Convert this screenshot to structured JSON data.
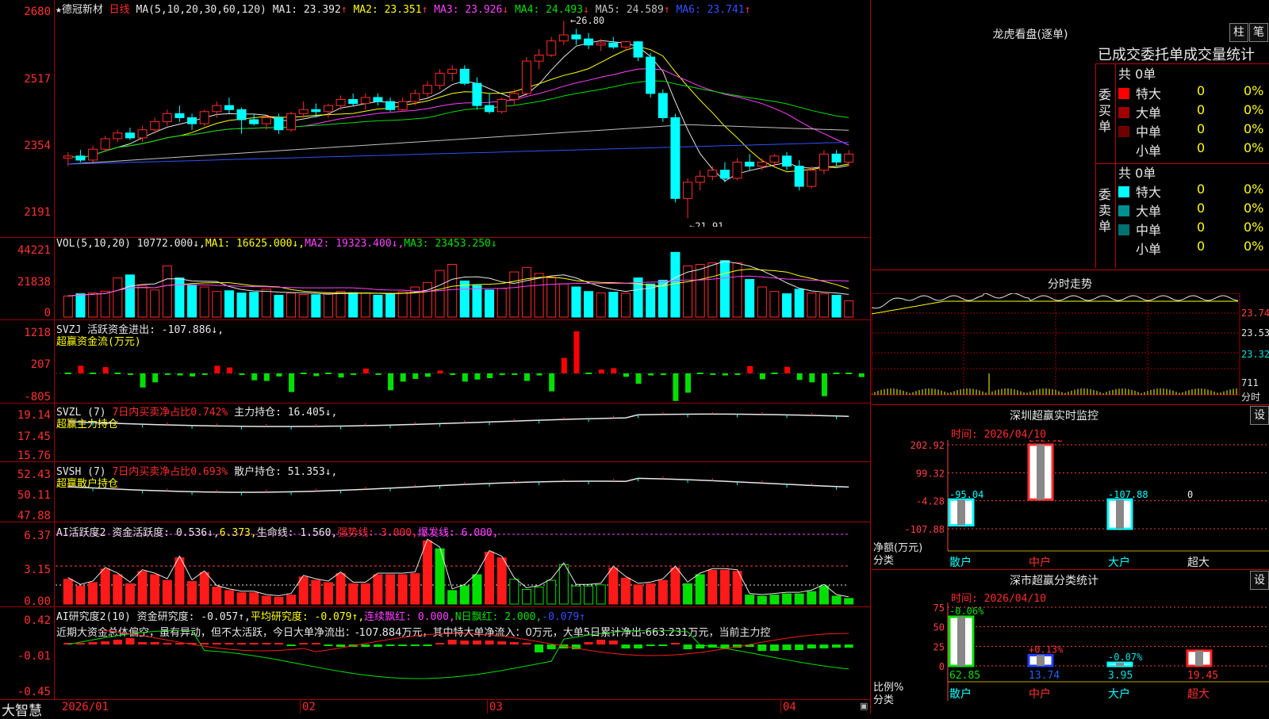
{
  "stock": {
    "title": "德冠新材",
    "period": "日线",
    "ma_label": "MA(5,10,20,30,60,120)",
    "ma": [
      {
        "label": "MA1: 23.392",
        "arrow": "↑",
        "color": "#e8e8e8"
      },
      {
        "label": "MA2: 23.351",
        "arrow": "↑",
        "color": "#ffff00"
      },
      {
        "label": "MA3: 23.926",
        "arrow": "↓",
        "color": "#ff40ff"
      },
      {
        "label": "MA4: 24.493",
        "arrow": "↓",
        "color": "#00e000"
      },
      {
        "label": "MA5: 24.589",
        "arrow": "↑",
        "color": "#c0c0c0"
      },
      {
        "label": "MA6: 23.741",
        "arrow": "↑",
        "color": "#3050ff"
      }
    ],
    "price_axis": [
      "2680",
      "2517",
      "2354",
      "2191"
    ],
    "high_marker": "26.80",
    "low_marker": "21.91"
  },
  "chart_data": [
    {
      "type": "candlestick",
      "title": "德冠新材 日线",
      "x": [
        "2026/01",
        "02",
        "03",
        "04"
      ],
      "ylim": [
        21.91,
        26.8
      ],
      "ohlc": [
        [
          23.4,
          23.55,
          23.2,
          23.45
        ],
        [
          23.45,
          23.6,
          23.3,
          23.35
        ],
        [
          23.35,
          23.7,
          23.3,
          23.62
        ],
        [
          23.62,
          23.95,
          23.55,
          23.88
        ],
        [
          23.88,
          24.1,
          23.8,
          24.02
        ],
        [
          24.02,
          24.15,
          23.85,
          23.9
        ],
        [
          23.9,
          24.2,
          23.8,
          24.1
        ],
        [
          24.1,
          24.4,
          24.0,
          24.3
        ],
        [
          24.3,
          24.6,
          24.2,
          24.5
        ],
        [
          24.5,
          24.7,
          24.3,
          24.4
        ],
        [
          24.4,
          24.5,
          24.1,
          24.25
        ],
        [
          24.25,
          24.6,
          24.2,
          24.55
        ],
        [
          24.55,
          24.8,
          24.4,
          24.7
        ],
        [
          24.7,
          24.9,
          24.5,
          24.6
        ],
        [
          24.6,
          24.65,
          24.0,
          24.35
        ],
        [
          24.35,
          24.5,
          24.2,
          24.25
        ],
        [
          24.25,
          24.45,
          24.1,
          24.4
        ],
        [
          24.4,
          24.5,
          24.0,
          24.1
        ],
        [
          24.1,
          24.55,
          24.05,
          24.5
        ],
        [
          24.5,
          24.8,
          24.4,
          24.6
        ],
        [
          24.6,
          24.75,
          24.4,
          24.55
        ],
        [
          24.55,
          24.75,
          24.4,
          24.7
        ],
        [
          24.7,
          24.95,
          24.6,
          24.85
        ],
        [
          24.85,
          25.0,
          24.7,
          24.75
        ],
        [
          24.75,
          25.0,
          24.6,
          24.9
        ],
        [
          24.9,
          25.0,
          24.7,
          24.8
        ],
        [
          24.8,
          24.9,
          24.55,
          24.6
        ],
        [
          24.6,
          24.9,
          24.55,
          24.8
        ],
        [
          24.8,
          25.1,
          24.7,
          25.0
        ],
        [
          25.0,
          25.3,
          24.9,
          25.2
        ],
        [
          25.2,
          25.6,
          25.1,
          25.5
        ],
        [
          25.5,
          25.7,
          25.3,
          25.6
        ],
        [
          25.6,
          25.7,
          25.2,
          25.25
        ],
        [
          25.25,
          25.4,
          24.6,
          24.7
        ],
        [
          24.7,
          25.0,
          24.5,
          24.55
        ],
        [
          24.55,
          24.9,
          24.5,
          24.85
        ],
        [
          24.85,
          25.1,
          24.7,
          25.0
        ],
        [
          25.0,
          25.9,
          24.95,
          25.8
        ],
        [
          25.8,
          26.1,
          25.6,
          25.95
        ],
        [
          25.95,
          26.4,
          25.9,
          26.3
        ],
        [
          26.3,
          26.8,
          26.2,
          26.45
        ],
        [
          26.45,
          26.6,
          26.2,
          26.35
        ],
        [
          26.35,
          26.5,
          26.1,
          26.2
        ],
        [
          26.2,
          26.35,
          26.05,
          26.25
        ],
        [
          26.25,
          26.4,
          26.1,
          26.15
        ],
        [
          26.15,
          26.3,
          26.05,
          26.28
        ],
        [
          26.28,
          26.3,
          25.8,
          25.9
        ],
        [
          25.9,
          26.0,
          24.9,
          25.0
        ],
        [
          25.0,
          25.1,
          24.3,
          24.4
        ],
        [
          24.4,
          24.5,
          22.3,
          22.4
        ],
        [
          22.4,
          22.9,
          21.91,
          22.8
        ],
        [
          22.8,
          23.1,
          22.6,
          22.95
        ],
        [
          22.95,
          23.2,
          22.85,
          23.1
        ],
        [
          23.1,
          23.3,
          22.8,
          22.9
        ],
        [
          22.9,
          23.4,
          22.85,
          23.3
        ],
        [
          23.3,
          23.5,
          23.1,
          23.2
        ],
        [
          23.2,
          23.4,
          23.1,
          23.3
        ],
        [
          23.3,
          23.5,
          23.2,
          23.45
        ],
        [
          23.45,
          23.55,
          23.1,
          23.2
        ],
        [
          23.2,
          23.35,
          22.6,
          22.7
        ],
        [
          22.7,
          23.2,
          22.65,
          23.1
        ],
        [
          23.1,
          23.6,
          23.0,
          23.5
        ],
        [
          23.5,
          23.6,
          23.2,
          23.3
        ],
        [
          23.3,
          23.6,
          23.2,
          23.5
        ]
      ]
    },
    {
      "type": "bar",
      "title": "VOL(5,10,20)",
      "ylim": [
        0,
        44221
      ],
      "values": [
        14000,
        15500,
        16000,
        17200,
        26000,
        28000,
        21000,
        18000,
        34000,
        26000,
        21000,
        20000,
        17000,
        17500,
        16000,
        16500,
        18500,
        14500,
        16000,
        15000,
        14800,
        15600,
        17000,
        16200,
        16000,
        14500,
        15200,
        16800,
        20000,
        23000,
        31000,
        35000,
        24000,
        21000,
        18000,
        19000,
        30000,
        33000,
        29000,
        26000,
        22000,
        20000,
        17000,
        16000,
        16500,
        15800,
        26000,
        22000,
        24500,
        43000,
        34000,
        35000,
        36000,
        37500,
        36000,
        25000,
        20000,
        17000,
        15500,
        18500,
        16000,
        15500,
        14500,
        10772
      ],
      "series_labels": [
        "VOL(5,10,20) 10772.000↓",
        "MA1: 16625.000↓",
        "MA2: 19323.400↓",
        "MA3: 23453.250↓"
      ]
    },
    {
      "type": "bar",
      "title": "SVZJ 活跃资金进出",
      "ylim": [
        -805,
        1218
      ],
      "values": [
        0,
        220,
        0,
        180,
        0,
        -40,
        -410,
        -260,
        -40,
        -60,
        -90,
        -40,
        220,
        170,
        -40,
        -200,
        -220,
        -90,
        -540,
        0,
        -80,
        0,
        -120,
        -40,
        140,
        -40,
        -490,
        -240,
        -160,
        -100,
        80,
        -40,
        -240,
        -180,
        -140,
        -50,
        -40,
        -220,
        -60,
        -520,
        450,
        1218,
        0,
        110,
        150,
        -100,
        -300,
        -60,
        -50,
        -800,
        -560,
        0,
        -40,
        -60,
        -40,
        210,
        -170,
        0,
        190,
        -190,
        -260,
        -660,
        0,
        0,
        -107.886
      ]
    }
  ],
  "indicators": {
    "vol": {
      "axis": [
        "44221",
        "21838",
        "0"
      ],
      "title": "VOL(5,10,20)",
      "value": "10772.000↓,",
      "ma1": "MA1: 16625.000↓,",
      "ma2": "MA2: 19323.400↓,",
      "ma3": "MA3: 23453.250↓"
    },
    "svzj": {
      "axis": [
        "1218",
        "207",
        "-805"
      ],
      "line1": "SVZJ  活跃资金进出: -107.886↓,",
      "line2": "超赢资金流(万元)"
    },
    "svzl": {
      "axis": [
        "19.14",
        "17.45",
        "15.76"
      ],
      "line1_prefix": "SVZL (7) ",
      "line1_red": "7日内买卖净占比0.742%",
      "line1_suffix": " 主力持仓: 16.405↓,",
      "line2": "超赢主力持仓"
    },
    "svsh": {
      "axis": [
        "52.43",
        "50.11",
        "47.88"
      ],
      "line1_prefix": "SVSH (7) ",
      "line1_red": "7日内买卖净占比0.693%",
      "line1_suffix": " 散户持仓: 51.353↓,",
      "line2": "超赢散户持仓"
    },
    "ai_active": {
      "axis": [
        "6.37",
        "3.15",
        "0.00"
      ],
      "label": "AI活跃度2 资金活跃度: 0.536↓,",
      "v2": "6.373,",
      "v3": "生命线: 1.560,",
      "v4": "强势线: 3.000,",
      "v5": "爆发线: 6.000,"
    },
    "ai_research": {
      "axis": [
        "0.42",
        "-0.01",
        "-0.45"
      ],
      "label": "AI研究度2(10) 资金研究度: -0.057↑,",
      "v2": "平均研究度: -0.079↑,",
      "v3": "连续飘红: 0.000,",
      "v4": "N日飘红: 2.000,",
      "v5": "-0.079↑",
      "summary": "近期大资金总体偏空，虽有异动，但不太活跃，今日大单净流出：-107.884万元，其中特大单净流入：0万元，大单5日累计净出-663.231万元，当前主力控"
    }
  },
  "x_axis": [
    "2026/01",
    "02",
    "03",
    "04"
  ],
  "brand": "大智慧",
  "right": {
    "lhb_title": "龙虎看盘(逐单)",
    "btn_bar": "柱",
    "btn_pen": "笔",
    "stat_header": "已成交委托单成交量统计",
    "buy_total": "共 0单",
    "sell_total": "共 0单",
    "buy_side": "委买单",
    "sell_side": "委卖单",
    "buy_rows": [
      {
        "name": "特大",
        "val": "0",
        "pct": "0%",
        "color": "#ff0000"
      },
      {
        "name": "大单",
        "val": "0",
        "pct": "0%",
        "color": "#a00000"
      },
      {
        "name": "中单",
        "val": "0",
        "pct": "0%",
        "color": "#700000"
      },
      {
        "name": "小单",
        "val": "0",
        "pct": "0%",
        "color": "#000000"
      }
    ],
    "sell_rows": [
      {
        "name": "特大",
        "val": "0",
        "pct": "0%",
        "color": "#00ffff"
      },
      {
        "name": "大单",
        "val": "0",
        "pct": "0%",
        "color": "#009090"
      },
      {
        "name": "中单",
        "val": "0",
        "pct": "0%",
        "color": "#007070"
      },
      {
        "name": "小单",
        "val": "0",
        "pct": "0%",
        "color": "#000000"
      }
    ],
    "intraday_title": "分时走势",
    "intraday_axis": [
      "23.74",
      "23.53",
      "23.32",
      "711",
      "分时"
    ],
    "monitor": {
      "title": "深圳超赢实时监控",
      "btn": "设",
      "time": "时间: 2026/04/10",
      "axis": [
        "202.92",
        "99.32",
        "-4.28",
        "-107.88"
      ],
      "ylabel": "净额(万元)",
      "xlabel": "分类",
      "categories": [
        "散户",
        "中户",
        "大户",
        "超大"
      ],
      "values": [
        "-95.04",
        "202.92",
        "-107.88",
        "0"
      ],
      "nums": [
        -95.04,
        202.92,
        -107.88,
        0
      ]
    },
    "classify": {
      "title": "深市超赢分类统计",
      "btn": "设",
      "time": "时间: 2026/04/10",
      "axis": [
        "75",
        "50",
        "25",
        "0"
      ],
      "ylabel": "比例%",
      "xlabel": "分类",
      "categories": [
        "散户",
        "中户",
        "大户",
        "超大"
      ],
      "values": [
        "62.85",
        "13.74",
        "3.95",
        "19.45"
      ],
      "changes": [
        "-0.06%",
        "+0.13%",
        "-0.07%",
        ""
      ],
      "nums": [
        62.85,
        13.74,
        3.95,
        19.45
      ]
    }
  }
}
